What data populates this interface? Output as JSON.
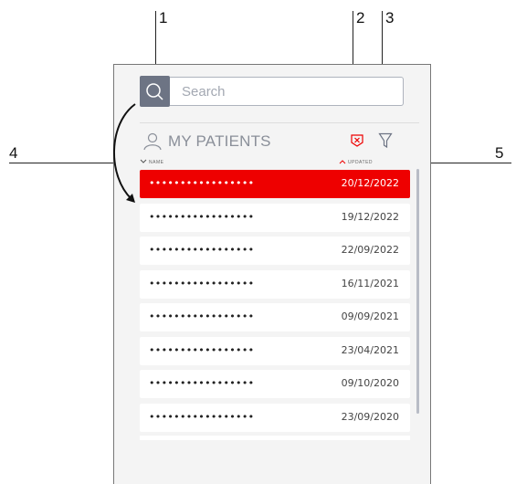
{
  "callouts": [
    "1",
    "2",
    "3",
    "4",
    "5"
  ],
  "search": {
    "placeholder": "Search"
  },
  "header": {
    "title": "MY PATIENTS"
  },
  "columns": {
    "name": "NAME",
    "updated": "UPDATED"
  },
  "colors": {
    "accent": "#ee0000",
    "search_button": "#6d7484"
  },
  "icons": {
    "search": "search-icon",
    "user": "user-icon",
    "clear_filter": "clear-filter-icon",
    "filter": "filter-icon",
    "sort_name": "chevron-down-icon",
    "sort_updated": "chevron-up-icon"
  },
  "patients": [
    {
      "name": "•••••••••••••••••",
      "date": "20/12/2022",
      "selected": true
    },
    {
      "name": "•••••••••••••••••",
      "date": "19/12/2022"
    },
    {
      "name": "•••••••••••••••••",
      "date": "22/09/2022"
    },
    {
      "name": "•••••••••••••••••",
      "date": "16/11/2021"
    },
    {
      "name": "•••••••••••••••••",
      "date": "09/09/2021"
    },
    {
      "name": "•••••••••••••••••",
      "date": "23/04/2021"
    },
    {
      "name": "•••••••••••••••••",
      "date": "09/10/2020"
    },
    {
      "name": "•••••••••••••••••",
      "date": "23/09/2020"
    }
  ]
}
